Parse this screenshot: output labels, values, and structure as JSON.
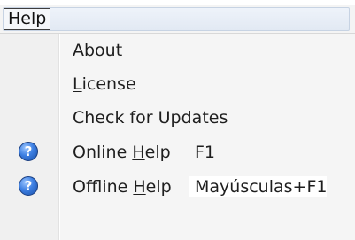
{
  "menubar": {
    "help_menu_label": "Help"
  },
  "help_menu": {
    "items": [
      {
        "label": "About"
      },
      {
        "label_before": "",
        "label_mnemonic": "L",
        "label_after": "icense"
      },
      {
        "label": "Check for Updates"
      },
      {
        "label_before": "Online ",
        "label_mnemonic": "H",
        "label_after": "elp",
        "shortcut": "F1",
        "icon": "help-question-icon"
      },
      {
        "label_before": "Offline ",
        "label_mnemonic": "H",
        "label_after": "elp",
        "shortcut": "Mayúsculas+F1",
        "icon": "help-question-icon"
      }
    ]
  },
  "colors": {
    "menubar_bg": "#f4f4f4",
    "dropdown_bg": "#f5f5f5",
    "icon_column_bg": "#f0f0f0",
    "help_icon_blue": "#3d7fe2",
    "text": "#1e1e1e"
  }
}
